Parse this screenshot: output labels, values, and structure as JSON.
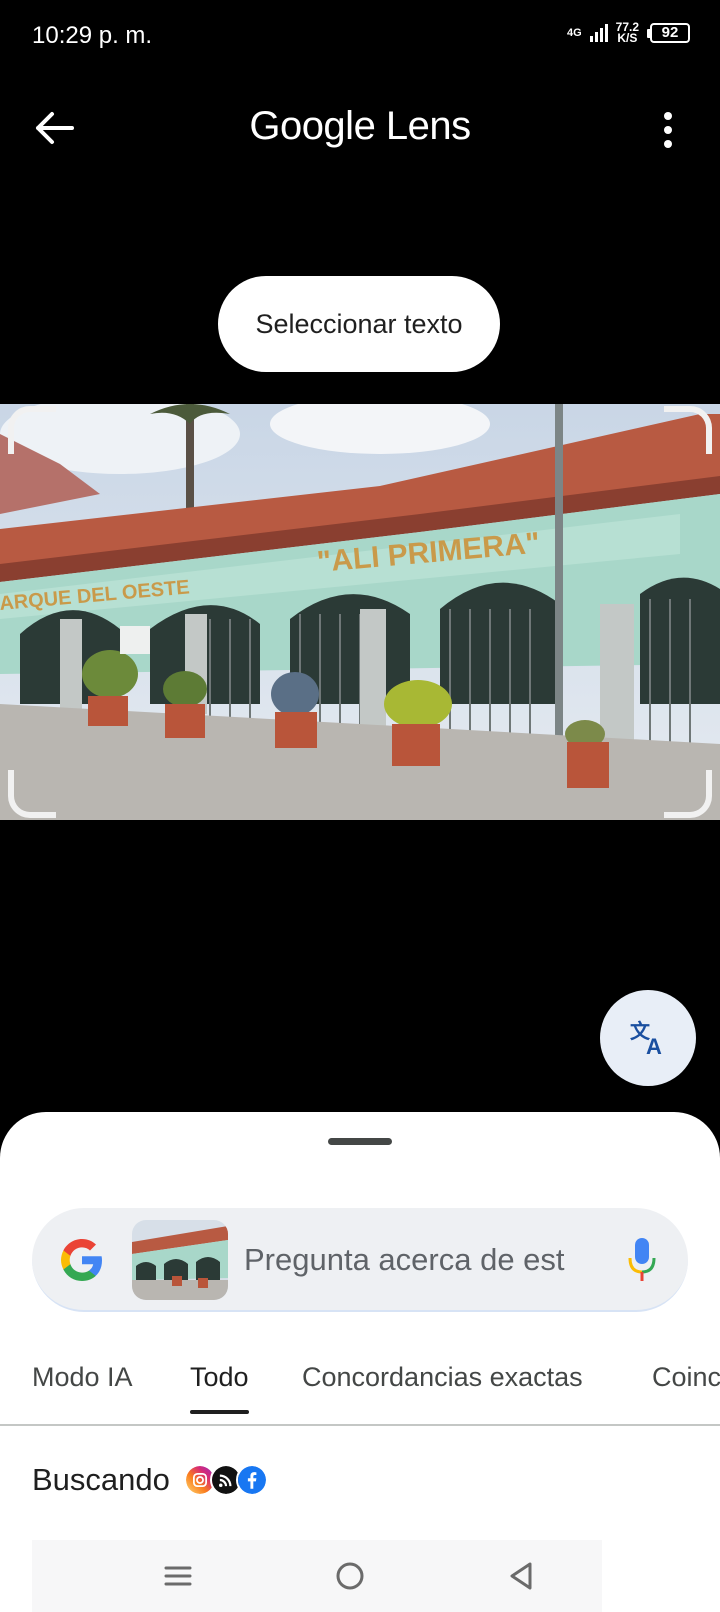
{
  "status_bar": {
    "time": "10:29 p. m.",
    "network_type": "4G",
    "speed_value": "77.2",
    "speed_unit": "K/S",
    "battery": "92",
    "icons": [
      "signal-icon",
      "battery-icon"
    ]
  },
  "app_bar": {
    "title": "Google Lens",
    "back_icon": "arrow-back-icon",
    "more_icon": "more-vert-icon"
  },
  "select_text_label": "Seleccionar texto",
  "photo": {
    "sign_left": "ARQUE DEL OESTE",
    "sign_right": "\"ALI PRIMERA\""
  },
  "translate_icon": "translate-icon",
  "sheet": {
    "search": {
      "placeholder": "Pregunta acerca de est",
      "logo": "google-g-icon",
      "mic_icon": "mic-icon"
    },
    "tabs": [
      {
        "label": "Modo IA",
        "active": false
      },
      {
        "label": "Todo",
        "active": true
      },
      {
        "label": "Concordancias exactas",
        "active": false
      },
      {
        "label": "Coinc",
        "active": false
      }
    ],
    "searching_label": "Buscando",
    "source_icons": [
      "instagram-icon",
      "rss-icon",
      "facebook-icon"
    ]
  },
  "nav_bar": {
    "icons": [
      "recents-icon",
      "home-icon",
      "back-triangle-icon"
    ]
  },
  "colors": {
    "background": "#000000",
    "sheet": "#ffffff",
    "fab": "#e8eef7",
    "accent_blue": "#1a73e8"
  }
}
